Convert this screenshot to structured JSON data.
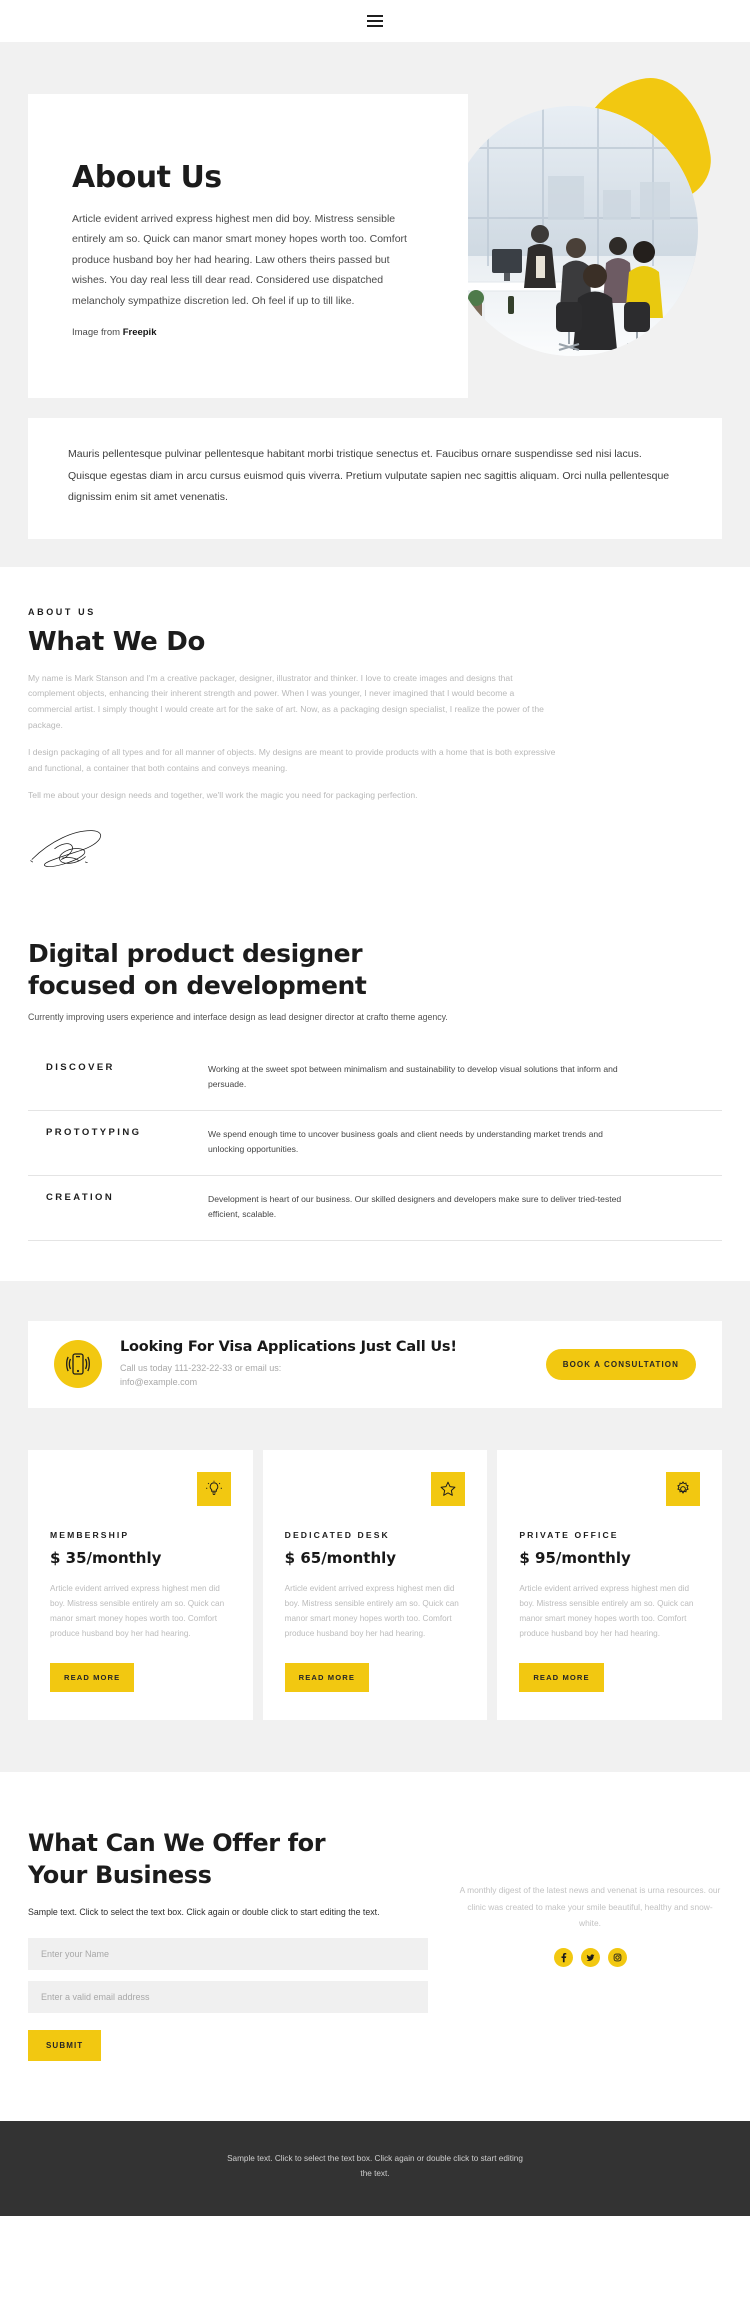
{
  "header": {
    "menu_icon": "hamburger-menu-icon"
  },
  "about": {
    "title": "About Us",
    "body": "Article evident arrived express highest men did boy. Mistress sensible entirely am so. Quick can manor smart money hopes worth too. Comfort produce husband boy her had hearing. Law others theirs passed but wishes. You day real less till dear read. Considered use dispatched melancholy sympathize discretion led. Oh feel if up to till like.",
    "credit_prefix": "Image from ",
    "credit_link": "Freepik",
    "photo_alt": "office-meeting-photo"
  },
  "quote": {
    "text": "Mauris pellentesque pulvinar pellentesque habitant morbi tristique senectus et. Faucibus ornare suspendisse sed nisi lacus. Quisque egestas diam in arcu cursus euismod quis viverra. Pretium vulputate sapien nec sagittis aliquam. Orci nulla pellentesque dignissim enim sit amet venenatis."
  },
  "whatwedo": {
    "eyebrow": "ABOUT US",
    "title": "What We Do",
    "p1": "My name is Mark Stanson and I'm a creative packager, designer, illustrator and thinker. I love to create images and designs that complement objects, enhancing their inherent strength and power. When I was younger, I never imagined that I would become a commercial artist. I simply thought I would create art for the sake of art. Now, as a packaging design specialist, I realize the power of the package.",
    "p2": "I design packaging of all types and for all manner of objects. My designs are meant to provide products with a home that is both expressive and functional, a container that both contains and conveys meaning.",
    "p3": "Tell me about your design needs and together, we'll work the magic you need for packaging perfection.",
    "signature_name": "signature-mark"
  },
  "digital": {
    "title_line1": "Digital product designer",
    "title_line2": "focused on development",
    "subtitle": "Currently improving users experience and interface design as lead designer director at crafto theme agency.",
    "steps": [
      {
        "label": "DISCOVER",
        "desc": "Working at the sweet spot between minimalism and sustainability to develop visual solutions that inform and persuade."
      },
      {
        "label": "PROTOTYPING",
        "desc": "We spend enough time to uncover business goals and client needs by understanding market trends and unlocking opportunities."
      },
      {
        "label": "CREATION",
        "desc": "Development is heart of our business. Our skilled designers and developers make sure to deliver tried-tested efficient, scalable."
      }
    ]
  },
  "cta": {
    "icon": "mobile-phone-ringing-icon",
    "title": "Looking For Visa Applications Just Call Us!",
    "subtitle": "Call us today 111-232-22-33 or email us: info@example.com",
    "button_label": "BOOK A CONSULTATION"
  },
  "pricing": {
    "cards": [
      {
        "icon": "lightbulb-icon",
        "name": "MEMBERSHIP",
        "price": "$ 35/monthly",
        "desc": "Article evident arrived express highest men did boy. Mistress sensible entirely am so. Quick can manor smart money hopes worth too. Comfort produce husband boy her had hearing.",
        "button_label": "READ MORE"
      },
      {
        "icon": "star-icon",
        "name": "DEDICATED DESK",
        "price": "$ 65/monthly",
        "desc": "Article evident arrived express highest men did boy. Mistress sensible entirely am so. Quick can manor smart money hopes worth too. Comfort produce husband boy her had hearing.",
        "button_label": "READ MORE"
      },
      {
        "icon": "gear-icon",
        "name": "PRIVATE OFFICE",
        "price": "$ 95/monthly",
        "desc": "Article evident arrived express highest men did boy. Mistress sensible entirely am so. Quick can manor smart money hopes worth too. Comfort produce husband boy her had hearing.",
        "button_label": "READ MORE"
      }
    ]
  },
  "offer": {
    "title_line1": "What Can We Offer for",
    "title_line2": "Your Business",
    "note": "Sample text. Click to select the text box. Click again or double click to start editing the text.",
    "name_placeholder": "Enter your Name",
    "email_placeholder": "Enter a valid email address",
    "name_value": "",
    "email_value": "",
    "submit_label": "SUBMIT",
    "digest": "A monthly digest of the latest news and venenat is urna resources. our clinic was created to make your smile beautiful, healthy and snow-white.",
    "socials": [
      {
        "name": "facebook-icon"
      },
      {
        "name": "twitter-icon"
      },
      {
        "name": "instagram-icon"
      }
    ]
  },
  "footer": {
    "text": "Sample text. Click to select the text box. Click again or double click to start editing the text."
  },
  "colors": {
    "accent": "#f2c811",
    "page_grey": "#f1f1f1",
    "footer_dark": "#333333",
    "ink": "#1c1c1c"
  }
}
